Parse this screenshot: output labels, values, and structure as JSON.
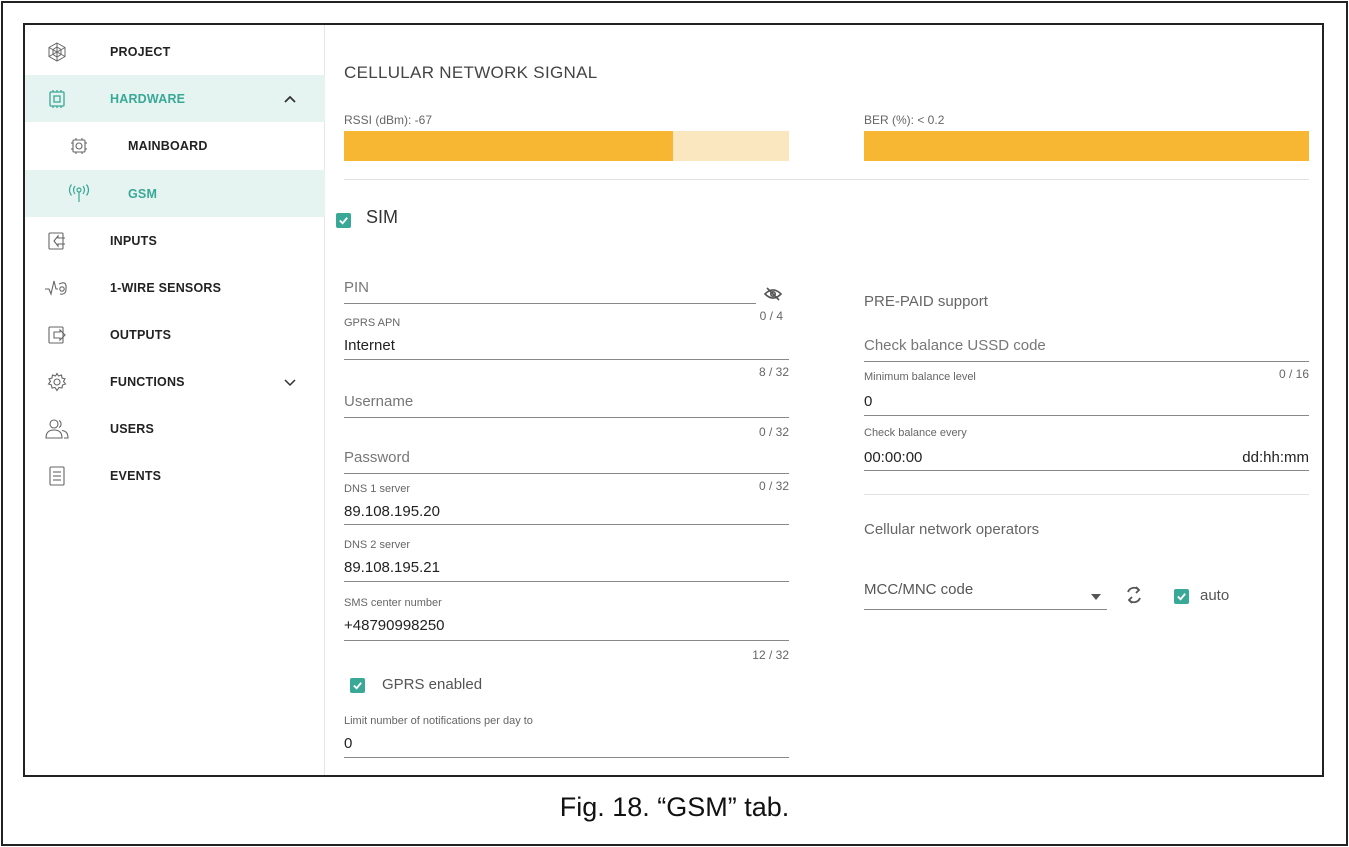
{
  "caption": "Fig. 18. “GSM” tab.",
  "sidebar": {
    "items": [
      {
        "label": "PROJECT",
        "icon": "project-icon"
      },
      {
        "label": "HARDWARE",
        "icon": "hardware-icon",
        "expanded": true
      },
      {
        "label": "MAINBOARD",
        "icon": "mainboard-icon"
      },
      {
        "label": "GSM",
        "icon": "antenna-icon",
        "active": true
      },
      {
        "label": "INPUTS",
        "icon": "inputs-icon"
      },
      {
        "label": "1-WIRE SENSORS",
        "icon": "sensor-icon"
      },
      {
        "label": "OUTPUTS",
        "icon": "outputs-icon"
      },
      {
        "label": "FUNCTIONS",
        "icon": "gear-icon",
        "expanded": false
      },
      {
        "label": "USERS",
        "icon": "users-icon"
      },
      {
        "label": "EVENTS",
        "icon": "events-icon"
      }
    ]
  },
  "signal": {
    "title": "CELLULAR NETWORK SIGNAL",
    "rssi_label": "RSSI (dBm): -67",
    "rssi_level": 0.74,
    "ber_label": "BER (%): < 0.2",
    "ber_level": 1.0
  },
  "colors": {
    "accent": "#3aa896",
    "bar_fill": "#f7b733",
    "bar_track": "#fbe7bf",
    "active_bg": "#e5f3f1"
  },
  "sim": {
    "label": "SIM",
    "checked": true,
    "pin": {
      "placeholder": "PIN",
      "counter": "0 / 4"
    },
    "gprs_apn": {
      "label": "GPRS APN",
      "value": "Internet",
      "counter": "8 / 32"
    },
    "username": {
      "placeholder": "Username",
      "counter": "0 / 32"
    },
    "password": {
      "placeholder": "Password",
      "counter": "0 / 32"
    },
    "dns1": {
      "label": "DNS 1 server",
      "value": "89.108.195.20"
    },
    "dns2": {
      "label": "DNS 2 server",
      "value": "89.108.195.21"
    },
    "sms_center": {
      "label": "SMS center number",
      "value": "+48790998250",
      "counter": "12 / 32"
    },
    "gprs_enabled": {
      "label": "GPRS enabled",
      "checked": true
    },
    "limit_notifications": {
      "label": "Limit number of notifications per day to",
      "value": "0"
    }
  },
  "prepaid": {
    "title": "PRE-PAID support",
    "ussd": {
      "placeholder": "Check balance USSD code",
      "counter": "0 / 16"
    },
    "min_balance": {
      "label": "Minimum balance level",
      "value": "0"
    },
    "check_every": {
      "label": "Check balance every",
      "value": "00:00:00",
      "suffix": "dd:hh:mm"
    }
  },
  "operators": {
    "title": "Cellular network operators",
    "mcc_placeholder": "MCC/MNC code",
    "auto_label": "auto",
    "auto_checked": true
  }
}
